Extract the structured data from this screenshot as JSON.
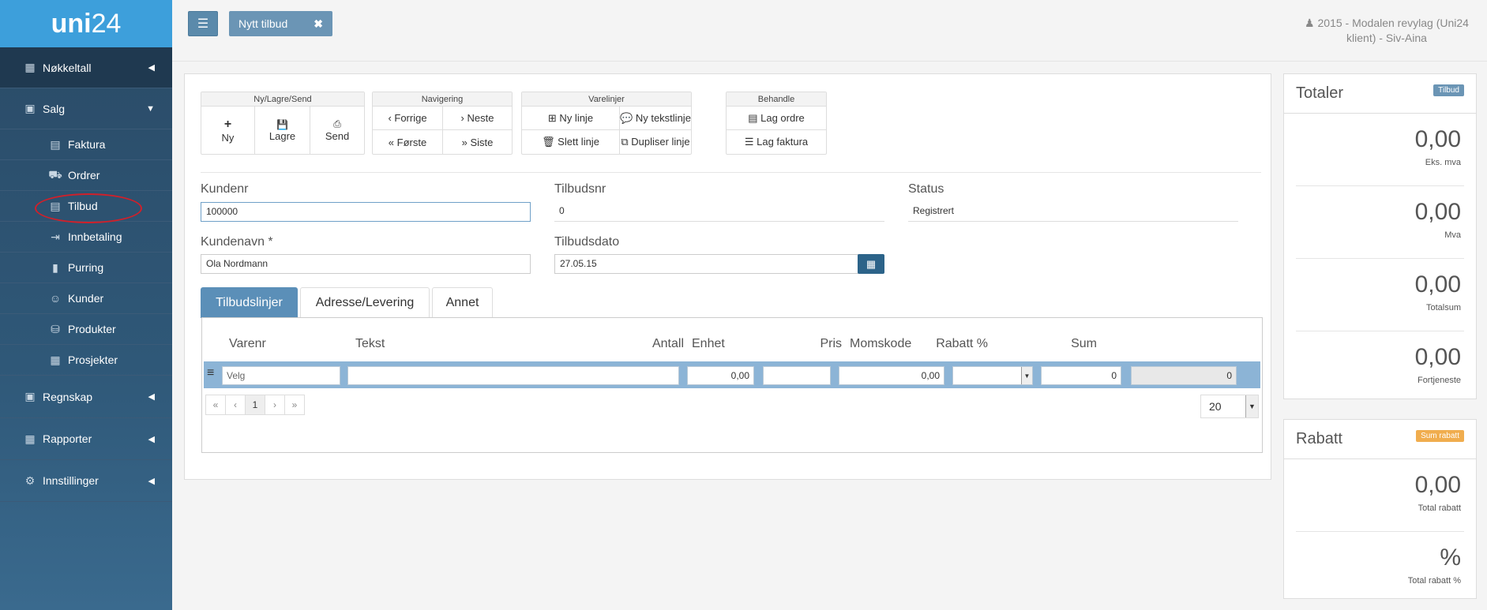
{
  "app": {
    "logo_bold": "uni",
    "logo_rest": "24"
  },
  "sidebar": {
    "items": [
      {
        "label": "Nøkkeltall",
        "icon": "chart-icon"
      },
      {
        "label": "Salg",
        "icon": "register-icon"
      },
      {
        "label": "Faktura",
        "icon": "invoice-icon"
      },
      {
        "label": "Ordrer",
        "icon": "cart-icon"
      },
      {
        "label": "Tilbud",
        "icon": "offer-icon"
      },
      {
        "label": "Innbetaling",
        "icon": "payment-icon"
      },
      {
        "label": "Purring",
        "icon": "reminder-icon"
      },
      {
        "label": "Kunder",
        "icon": "customer-icon"
      },
      {
        "label": "Produkter",
        "icon": "product-icon"
      },
      {
        "label": "Prosjekter",
        "icon": "project-icon"
      },
      {
        "label": "Regnskap",
        "icon": "accounting-icon"
      },
      {
        "label": "Rapporter",
        "icon": "report-icon"
      },
      {
        "label": "Innstillinger",
        "icon": "settings-icon"
      }
    ]
  },
  "topbar": {
    "menu_icon": "☰",
    "tab_label": "Nytt tilbud",
    "tab_close": "✖",
    "user_line1": "2015 - Modalen revylag (Uni24",
    "user_line2": "klient) - Siv-Aina"
  },
  "toolbar": {
    "groups": [
      {
        "title": "Ny/Lagre/Send"
      },
      {
        "title": "Navigering"
      },
      {
        "title": "Varelinjer"
      },
      {
        "title": "Behandle"
      }
    ],
    "ny": "Ny",
    "lagre": "Lagre",
    "send": "Send",
    "forrige": "‹ Forrige",
    "neste": "› Neste",
    "forste": "« Første",
    "siste": "» Siste",
    "ny_linje": "⊞ Ny linje",
    "ny_tekstlinje": "💬 Ny tekstlinje",
    "slett_linje": "🗑 Slett linje",
    "dupliser_linje": "⧉ Dupliser linje",
    "lag_ordre": "▤ Lag ordre",
    "lag_faktura": "☰ Lag faktura"
  },
  "form": {
    "kundenr_label": "Kundenr",
    "kundenr": "100000",
    "tilbudsnr_label": "Tilbudsnr",
    "tilbudsnr": "0",
    "status_label": "Status",
    "status": "Registrert",
    "kundenavn_label": "Kundenavn *",
    "kundenavn": "Ola Nordmann",
    "tilbudsdato_label": "Tilbudsdato",
    "tilbudsdato": "27.05.15"
  },
  "tabs": [
    "Tilbudslinjer",
    "Adresse/Levering",
    "Annet"
  ],
  "grid": {
    "columns": [
      "Varenr",
      "Tekst",
      "Antall",
      "Enhet",
      "Pris",
      "Momskode",
      "Rabatt %",
      "Sum"
    ],
    "row": {
      "varenr": "Velg",
      "tekst": "",
      "antall": "0,00",
      "enhet": "",
      "pris": "0,00",
      "momskode": "",
      "rabatt": "0",
      "sum": "0"
    },
    "pager": [
      "«",
      "‹",
      "1",
      "›",
      "»"
    ],
    "page_size": "20"
  },
  "totals": {
    "title": "Totaler",
    "badge": "Tilbud",
    "badge_color": "#6b95b5",
    "items": [
      {
        "value": "0,00",
        "label": "Eks. mva"
      },
      {
        "value": "0,00",
        "label": "Mva"
      },
      {
        "value": "0,00",
        "label": "Totalsum"
      },
      {
        "value": "0,00",
        "label": "Fortjeneste"
      }
    ]
  },
  "rabatt": {
    "title": "Rabatt",
    "badge": "Sum rabatt",
    "badge_color": "#f0ad4e",
    "items": [
      {
        "value": "0,00",
        "label": "Total rabatt"
      },
      {
        "value": "%",
        "label": "Total rabatt %"
      }
    ]
  }
}
